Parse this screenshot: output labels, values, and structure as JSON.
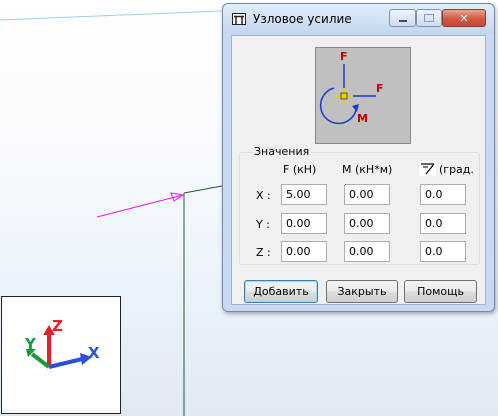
{
  "dialog": {
    "title": "Узловое усилие",
    "group_label": "Значения",
    "columns": {
      "force": "F (кН)",
      "moment": "М (кН*м)",
      "angle": "(град."
    },
    "rows": [
      {
        "label": "X :",
        "force": "5.00",
        "moment": "0.00",
        "angle": "0.0"
      },
      {
        "label": "Y :",
        "force": "0.00",
        "moment": "0.00",
        "angle": "0.0"
      },
      {
        "label": "Z :",
        "force": "0.00",
        "moment": "0.00",
        "angle": "0.0"
      }
    ],
    "preview_labels": {
      "force_vertical": "F",
      "force_horizontal": "F",
      "moment": "M"
    },
    "buttons": {
      "add": "Добавить",
      "close": "Закрыть",
      "help": "Помощь"
    }
  },
  "axes": {
    "x": "X",
    "y": "Y",
    "z": "Z"
  },
  "icons": {
    "app": "frame-icon",
    "angle": "angle-icon",
    "minimize": "minimize-icon",
    "maximize": "maximize-icon",
    "close": "close-icon"
  },
  "colors": {
    "axis_x": "#2b4fd6",
    "axis_y": "#1a9a3a",
    "axis_z": "#e0202a",
    "load_arrow": "#e020e0",
    "preview_force": "#1a3ad0",
    "preview_label": "#c00000"
  }
}
